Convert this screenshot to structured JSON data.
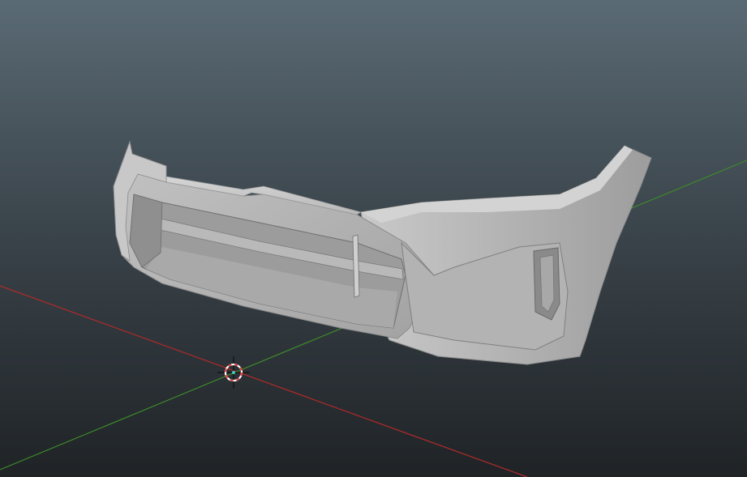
{
  "viewport": {
    "background_top": "#5a6a74",
    "background_bottom": "#1f2326",
    "axis_x_color": "#b02a2a",
    "axis_y_color": "#3f8a2a"
  },
  "model": {
    "name": "front-bumper",
    "base_color": "#b5b5b5",
    "shadow_color": "#7f7f7f",
    "highlight_color": "#d4d4d4"
  },
  "cursor": {
    "icon": "3d-cursor-icon",
    "ring_color": "#e04545",
    "center_color": "#40c8c8"
  }
}
